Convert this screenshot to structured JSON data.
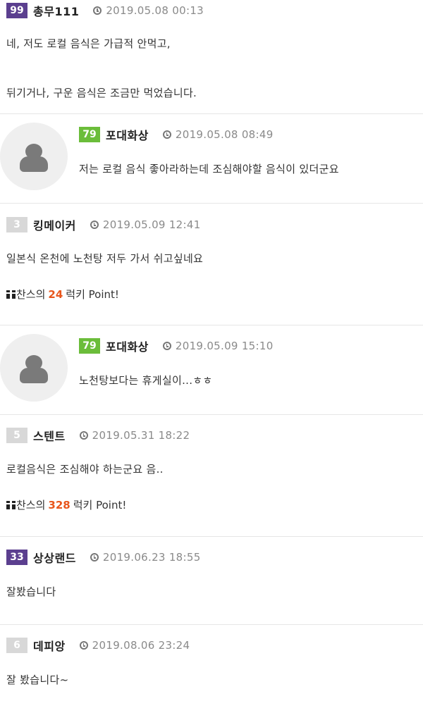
{
  "comments": [
    {
      "level": "99",
      "level_color": "#5b3f8f",
      "author": "총무111",
      "date": "2019.05.08 00:13",
      "lines": [
        "네, 저도 로컬 음식은 가급적 안먹고,",
        "뒤기거나, 구운 음식은 조금만 먹었습니다."
      ]
    },
    {
      "level": "79",
      "level_color": "#6bbd3a",
      "author": "포대화상",
      "date": "2019.05.08 08:49",
      "lines": [
        "저는 로컬 음식 좋아라하는데 조심해야할 음식이 있더군요"
      ]
    },
    {
      "level": "3",
      "level_color": "#d8d8d8",
      "author": "킹메이커",
      "date": "2019.05.09 12:41",
      "lines": [
        "일본식 온천에 노천탕 저두 가서 쉬고싶네요"
      ],
      "lucky": {
        "prefix": "찬스의",
        "points": "24",
        "suffix": "럭키 Point!"
      }
    },
    {
      "level": "79",
      "level_color": "#6bbd3a",
      "author": "포대화상",
      "date": "2019.05.09 15:10",
      "lines": [
        "노천탕보다는 휴게실이...ㅎㅎ"
      ]
    },
    {
      "level": "5",
      "level_color": "#d8d8d8",
      "author": "스텐트",
      "date": "2019.05.31 18:22",
      "lines": [
        "로컬음식은 조심해야 하는군요 음.."
      ],
      "lucky": {
        "prefix": "찬스의",
        "points": "328",
        "suffix": "럭키 Point!"
      }
    },
    {
      "level": "33",
      "level_color": "#5b3f8f",
      "author": "상상랜드",
      "date": "2019.06.23 18:55",
      "lines": [
        "잘봤습니다"
      ]
    },
    {
      "level": "6",
      "level_color": "#d8d8d8",
      "author": "데피앙",
      "date": "2019.08.06 23:24",
      "lines": [
        "잘 봤습니다~"
      ]
    }
  ],
  "icons": {
    "clock": "clock-icon",
    "avatar": "user-avatar-icon",
    "gift": "gift-icon"
  },
  "colors": {
    "points": "#e8561c",
    "divider": "#e6e6e6",
    "date": "#8a8a8a"
  }
}
